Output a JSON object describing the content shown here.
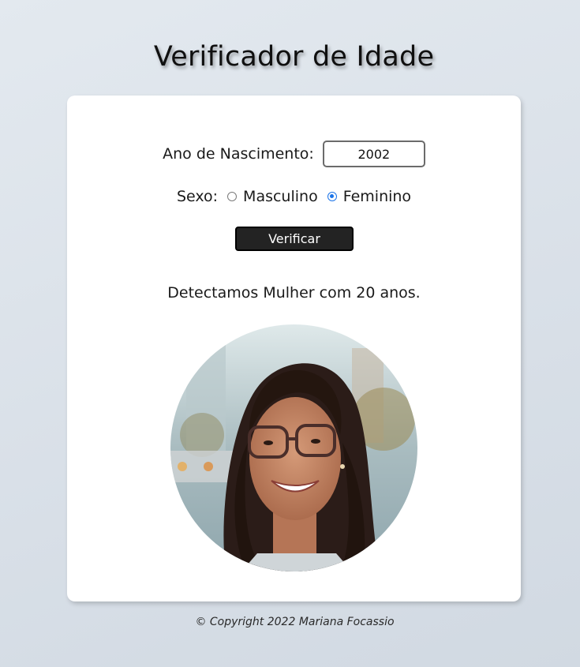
{
  "header": {
    "title": "Verificador de Idade"
  },
  "form": {
    "birth_year_label": "Ano de Nascimento:",
    "birth_year_value": "2002",
    "sex_label": "Sexo:",
    "sex_options": [
      {
        "label": "Masculino",
        "checked": false
      },
      {
        "label": "Feminino",
        "checked": true
      }
    ],
    "verify_label": "Verificar"
  },
  "result": {
    "text": "Detectamos Mulher com 20 anos."
  },
  "footer": {
    "copyright": "© Copyright 2022 Mariana Focassio"
  },
  "colors": {
    "accent": "#1a73e8",
    "button_bg": "#232323"
  }
}
